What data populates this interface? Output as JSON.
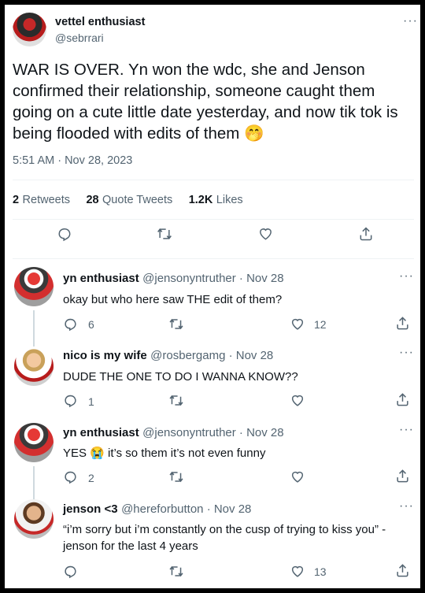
{
  "main_tweet": {
    "display_name": "vettel enthusiast",
    "handle": "@sebrrari",
    "text": "WAR IS OVER. Yn won the wdc, she and Jenson confirmed their relationship, someone caught them going on a cute little date yesterday, and now tik tok is being flooded with edits of them",
    "emoji": "🤭",
    "timestamp": "5:51 AM · Nov 28, 2023",
    "stats": {
      "retweets_num": "2",
      "retweets_label": "Retweets",
      "quotes_num": "28",
      "quotes_label": "Quote Tweets",
      "likes_num": "1.2K",
      "likes_label": "Likes"
    }
  },
  "replies": [
    {
      "display_name": "yn enthusiast",
      "meta": "@jensonyntruther · Nov 28",
      "text": "okay but who here saw THE edit of them?",
      "reply_count": "6",
      "like_count": "12"
    },
    {
      "display_name": "nico is my wife",
      "meta": "@rosbergamg · Nov 28",
      "text": "DUDE THE ONE TO DO I WANNA KNOW??",
      "reply_count": "1",
      "like_count": ""
    },
    {
      "display_name": "yn enthusiast",
      "meta": "@jensonyntruther · Nov 28",
      "text_before": "YES",
      "emoji": "😭",
      "text_after": "it’s so them it’s not even funny",
      "reply_count": "2",
      "like_count": ""
    },
    {
      "display_name": "jenson <3",
      "meta": "@hereforbutton · Nov 28",
      "text_line1": "“i’m sorry but i’m constantly on the cusp of trying to kiss you” -",
      "text_line2": "jenson for the last 4 years",
      "reply_count": "",
      "like_count": "13"
    }
  ],
  "more_label": "···",
  "colors": {
    "secondary": "#536471",
    "text": "#0f1419",
    "divider": "#eff3f4"
  }
}
